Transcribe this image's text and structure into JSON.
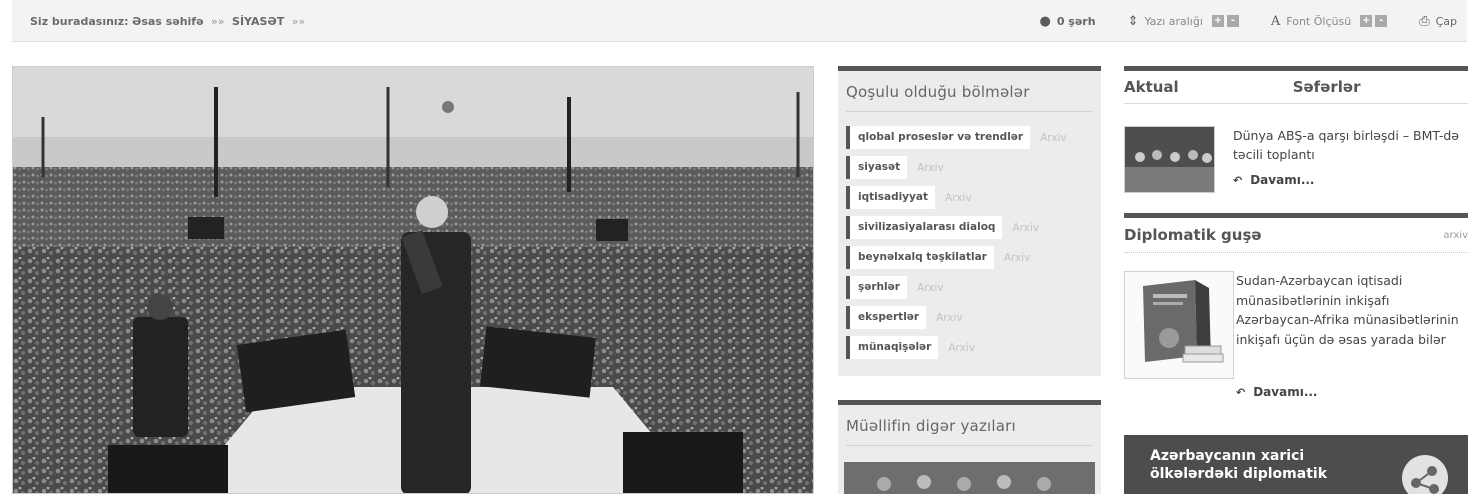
{
  "breadcrumb": {
    "prefix": "Siz buradasınız:",
    "home": "Əsas səhifə",
    "separator": "»»",
    "current": "SİYASƏT",
    "trailing": "»»"
  },
  "toolbar": {
    "comments": "0 şərh",
    "line_spacing": "Yazı aralığı",
    "font_size": "Font Ölçüsü",
    "plus": "+",
    "minus": "-",
    "print": "Çap"
  },
  "categories_box": {
    "title": "Qoşulu olduğu bölmələr",
    "archive_label": "Arxiv",
    "items": [
      "qlobal proseslər və trendlər",
      "siyasət",
      "iqtisadiyyat",
      "sivilizasiyalarası dialoq",
      "beynəlxalq təşkilatlar",
      "şərhlər",
      "ekspertlər",
      "münaqişələr"
    ]
  },
  "author_box": {
    "title": "Müəllifin digər yazıları"
  },
  "aktual": {
    "tab1": "Aktual",
    "tab2": "Səfərlər",
    "headline": "Dünya ABŞ-a qarşı birləşdi – BMT-də təcili toplantı",
    "more": "Davamı..."
  },
  "diplomatic": {
    "title": "Diplomatik guşə",
    "archive": "arxiv",
    "headline": "Sudan-Azərbaycan iqtisadi münasibətlərinin inkişafı Azərbaycan-Afrika münasibətlərinin inkişafı üçün də əsas yarada bilər",
    "more": "Davamı..."
  },
  "promo": {
    "line1": "Azərbaycanın xarici",
    "line2": "ölkələrdəki diplomatik"
  },
  "colors": {
    "toolbar_bg": "#f3f3f3",
    "box_bg": "#ececec",
    "accent_dark": "#555555"
  }
}
